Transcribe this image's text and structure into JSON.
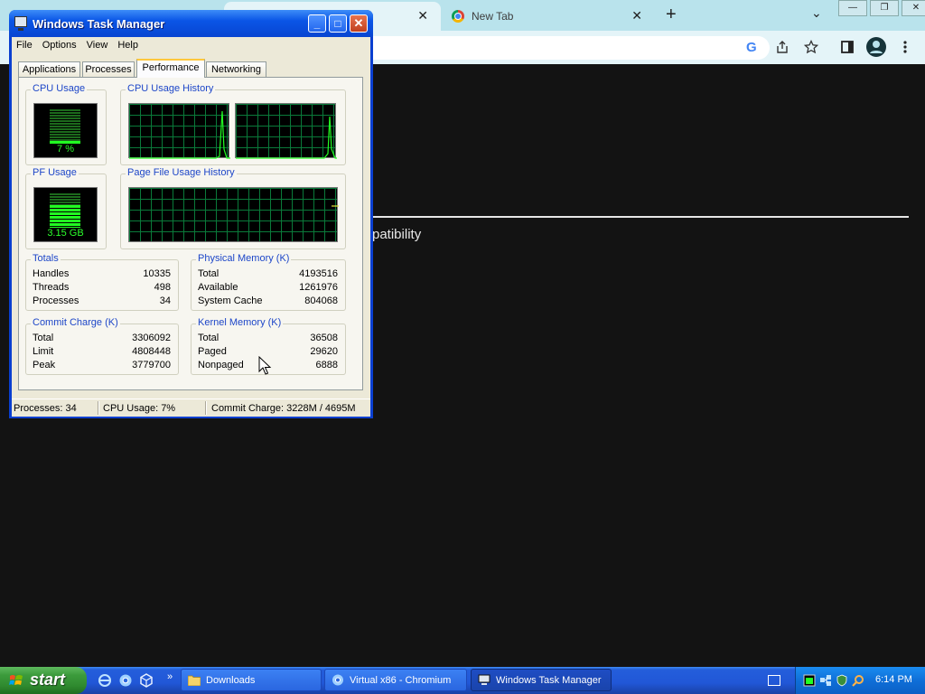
{
  "browser": {
    "tabs": [
      {
        "title": "",
        "active": true
      },
      {
        "title": "New Tab",
        "active": false
      }
    ],
    "tab_close_glyph": "✕",
    "new_tab_glyph": "+",
    "tab_search_glyph": "⌄",
    "window_controls": [
      "—",
      "❐",
      "✕"
    ],
    "toolbar_icons": [
      "google-g-icon",
      "share-icon",
      "star-icon",
      "side-panel-icon",
      "profile-icon",
      "more-menu-icon"
    ],
    "google_g": "G",
    "page_text_fragment": "patibility"
  },
  "task_manager": {
    "title": "Windows Task Manager",
    "controls": {
      "minimize": "_",
      "maximize": "□",
      "close": "✕"
    },
    "menu": [
      "File",
      "Options",
      "View",
      "Help"
    ],
    "tabs": [
      "Applications",
      "Processes",
      "Performance",
      "Networking"
    ],
    "selected_tab": "Performance",
    "cpu_usage": {
      "label": "CPU Usage",
      "value": "7 %",
      "percent": 7
    },
    "cpu_history": {
      "label": "CPU Usage History"
    },
    "pf_usage": {
      "label": "PF Usage",
      "value": "3.15 GB",
      "fraction": 0.67
    },
    "pf_history": {
      "label": "Page File Usage History"
    },
    "totals": {
      "label": "Totals",
      "rows": [
        {
          "k": "Handles",
          "v": "10335"
        },
        {
          "k": "Threads",
          "v": "498"
        },
        {
          "k": "Processes",
          "v": "34"
        }
      ]
    },
    "physical_memory": {
      "label": "Physical Memory (K)",
      "rows": [
        {
          "k": "Total",
          "v": "4193516"
        },
        {
          "k": "Available",
          "v": "1261976"
        },
        {
          "k": "System Cache",
          "v": "804068"
        }
      ]
    },
    "commit_charge": {
      "label": "Commit Charge (K)",
      "rows": [
        {
          "k": "Total",
          "v": "3306092"
        },
        {
          "k": "Limit",
          "v": "4808448"
        },
        {
          "k": "Peak",
          "v": "3779700"
        }
      ]
    },
    "kernel_memory": {
      "label": "Kernel Memory (K)",
      "rows": [
        {
          "k": "Total",
          "v": "36508"
        },
        {
          "k": "Paged",
          "v": "29620"
        },
        {
          "k": "Nonpaged",
          "v": "6888"
        }
      ]
    },
    "status": {
      "processes": "Processes: 34",
      "cpu": "CPU Usage: 7%",
      "commit": "Commit Charge: 3228M / 4695M"
    }
  },
  "taskbar": {
    "start_label": "start",
    "quick_launch": [
      "internet-explorer-icon",
      "chromium-icon",
      "virtualbox-icon"
    ],
    "quick_launch_more": "»",
    "buttons": [
      {
        "label": "Downloads",
        "icon": "folder-icon",
        "active": false
      },
      {
        "label": "Virtual x86 - Chromium",
        "icon": "chromium-icon",
        "active": false
      },
      {
        "label": "Windows Task Manager",
        "icon": "task-manager-icon",
        "active": true
      }
    ],
    "tray_icons": [
      "keyboard-icon",
      "task-manager-tray-icon",
      "network-icon",
      "security-icon",
      "search-icon"
    ],
    "clock": "6:14 PM"
  },
  "colors": {
    "xp_blue": "#0a55e6",
    "graph_green": "#22ff22",
    "group_title": "#1d46c8",
    "start_green": "#3c9b3c"
  }
}
